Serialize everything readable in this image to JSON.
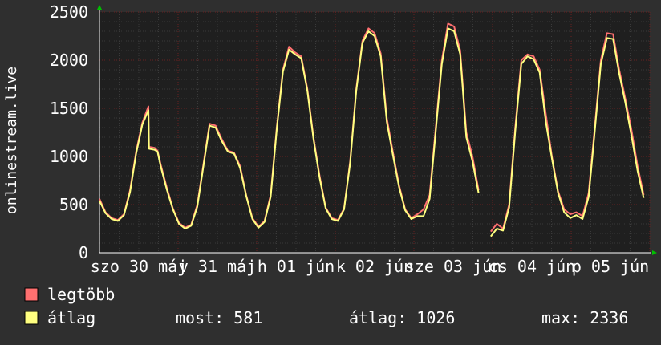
{
  "chart_data": {
    "type": "line",
    "ylabel": "onlinestream.live",
    "ylim": [
      0,
      2500
    ],
    "yticks": [
      0,
      500,
      1000,
      1500,
      2000,
      2500
    ],
    "grid": true,
    "x_tick_labels": [
      "szo 30 máj",
      "v 31 máj",
      "h 01 jún",
      "k 02 jún",
      "sze 03 jún",
      "cs 04 jún",
      "p 05 jún"
    ],
    "legend_position": "bottom-left",
    "series": [
      {
        "name": "legtöbb",
        "color": "#ff7070",
        "values": [
          [
            0,
            560
          ],
          [
            1,
            420
          ],
          [
            2,
            360
          ],
          [
            3,
            340
          ],
          [
            4,
            400
          ],
          [
            5,
            650
          ],
          [
            6,
            1050
          ],
          [
            7,
            1350
          ],
          [
            8,
            1520
          ],
          [
            8.1,
            1100
          ],
          [
            9,
            1090
          ],
          [
            9.5,
            1060
          ],
          [
            10,
            920
          ],
          [
            11,
            680
          ],
          [
            12,
            460
          ],
          [
            13,
            310
          ],
          [
            14,
            260
          ],
          [
            15,
            290
          ],
          [
            16,
            500
          ],
          [
            17,
            920
          ],
          [
            18,
            1340
          ],
          [
            19,
            1320
          ],
          [
            20,
            1180
          ],
          [
            21,
            1060
          ],
          [
            22,
            1040
          ],
          [
            23,
            900
          ],
          [
            24,
            600
          ],
          [
            25,
            360
          ],
          [
            26,
            270
          ],
          [
            27,
            330
          ],
          [
            28,
            600
          ],
          [
            29,
            1300
          ],
          [
            30,
            1900
          ],
          [
            31,
            2140
          ],
          [
            32,
            2080
          ],
          [
            33,
            2040
          ],
          [
            34,
            1700
          ],
          [
            35,
            1200
          ],
          [
            36,
            800
          ],
          [
            37,
            470
          ],
          [
            38,
            360
          ],
          [
            39,
            340
          ],
          [
            40,
            460
          ],
          [
            41,
            950
          ],
          [
            42,
            1700
          ],
          [
            43,
            2200
          ],
          [
            44,
            2330
          ],
          [
            45,
            2280
          ],
          [
            46,
            2070
          ],
          [
            47,
            1400
          ],
          [
            48,
            1040
          ],
          [
            49,
            700
          ],
          [
            50,
            450
          ],
          [
            51,
            360
          ],
          [
            52,
            400
          ],
          [
            53,
            450
          ],
          [
            54,
            600
          ],
          [
            55,
            1300
          ],
          [
            56,
            2000
          ],
          [
            57,
            2380
          ],
          [
            58,
            2350
          ],
          [
            59,
            2100
          ],
          [
            60,
            1250
          ],
          [
            61,
            1000
          ],
          [
            62,
            650
          ],
          [
            64,
            220
          ],
          [
            65,
            300
          ],
          [
            66,
            250
          ],
          [
            67,
            500
          ],
          [
            68,
            1300
          ],
          [
            69,
            2000
          ],
          [
            70,
            2060
          ],
          [
            71,
            2040
          ],
          [
            72,
            1900
          ],
          [
            73,
            1440
          ],
          [
            74,
            1000
          ],
          [
            75,
            640
          ],
          [
            76,
            450
          ],
          [
            77,
            400
          ],
          [
            78,
            420
          ],
          [
            79,
            380
          ],
          [
            80,
            620
          ],
          [
            81,
            1300
          ],
          [
            82,
            2000
          ],
          [
            83,
            2280
          ],
          [
            84,
            2270
          ],
          [
            85,
            1900
          ],
          [
            86,
            1600
          ],
          [
            87,
            1280
          ],
          [
            88,
            900
          ],
          [
            89,
            600
          ]
        ]
      },
      {
        "name": "átlag",
        "color": "#ffff80",
        "values": [
          [
            0,
            540
          ],
          [
            1,
            410
          ],
          [
            2,
            350
          ],
          [
            3,
            330
          ],
          [
            4,
            390
          ],
          [
            5,
            630
          ],
          [
            6,
            1030
          ],
          [
            7,
            1330
          ],
          [
            8,
            1480
          ],
          [
            8.1,
            1080
          ],
          [
            9,
            1070
          ],
          [
            9.5,
            1050
          ],
          [
            10,
            900
          ],
          [
            11,
            660
          ],
          [
            12,
            450
          ],
          [
            13,
            300
          ],
          [
            14,
            250
          ],
          [
            15,
            280
          ],
          [
            16,
            480
          ],
          [
            17,
            900
          ],
          [
            18,
            1320
          ],
          [
            19,
            1300
          ],
          [
            20,
            1160
          ],
          [
            21,
            1050
          ],
          [
            22,
            1030
          ],
          [
            23,
            880
          ],
          [
            24,
            590
          ],
          [
            25,
            350
          ],
          [
            26,
            260
          ],
          [
            27,
            320
          ],
          [
            28,
            580
          ],
          [
            29,
            1280
          ],
          [
            30,
            1880
          ],
          [
            31,
            2110
          ],
          [
            32,
            2060
          ],
          [
            33,
            2020
          ],
          [
            34,
            1680
          ],
          [
            35,
            1180
          ],
          [
            36,
            780
          ],
          [
            37,
            460
          ],
          [
            38,
            350
          ],
          [
            39,
            330
          ],
          [
            40,
            450
          ],
          [
            41,
            930
          ],
          [
            42,
            1680
          ],
          [
            43,
            2180
          ],
          [
            44,
            2300
          ],
          [
            45,
            2250
          ],
          [
            46,
            2040
          ],
          [
            47,
            1360
          ],
          [
            48,
            1010
          ],
          [
            49,
            680
          ],
          [
            50,
            440
          ],
          [
            51,
            350
          ],
          [
            52,
            380
          ],
          [
            53,
            380
          ],
          [
            54,
            560
          ],
          [
            55,
            1260
          ],
          [
            56,
            1960
          ],
          [
            57,
            2330
          ],
          [
            58,
            2300
          ],
          [
            59,
            2060
          ],
          [
            60,
            1200
          ],
          [
            61,
            950
          ],
          [
            62,
            620
          ],
          [
            64,
            170
          ],
          [
            65,
            250
          ],
          [
            66,
            230
          ],
          [
            67,
            470
          ],
          [
            68,
            1260
          ],
          [
            69,
            1960
          ],
          [
            70,
            2040
          ],
          [
            71,
            2010
          ],
          [
            72,
            1870
          ],
          [
            73,
            1360
          ],
          [
            74,
            980
          ],
          [
            75,
            620
          ],
          [
            76,
            420
          ],
          [
            77,
            360
          ],
          [
            78,
            390
          ],
          [
            79,
            350
          ],
          [
            80,
            580
          ],
          [
            81,
            1260
          ],
          [
            82,
            1960
          ],
          [
            83,
            2230
          ],
          [
            84,
            2220
          ],
          [
            85,
            1860
          ],
          [
            86,
            1560
          ],
          [
            87,
            1220
          ],
          [
            88,
            850
          ],
          [
            89,
            570
          ]
        ]
      }
    ],
    "x_range": [
      0,
      90
    ]
  },
  "legend": {
    "items": [
      "legtöbb",
      "átlag"
    ],
    "stats": {
      "most_label": "most:",
      "most_value": "581",
      "atlag_label": "átlag:",
      "atlag_value": "1026",
      "max_label": "max:",
      "max_value": "2336"
    }
  }
}
